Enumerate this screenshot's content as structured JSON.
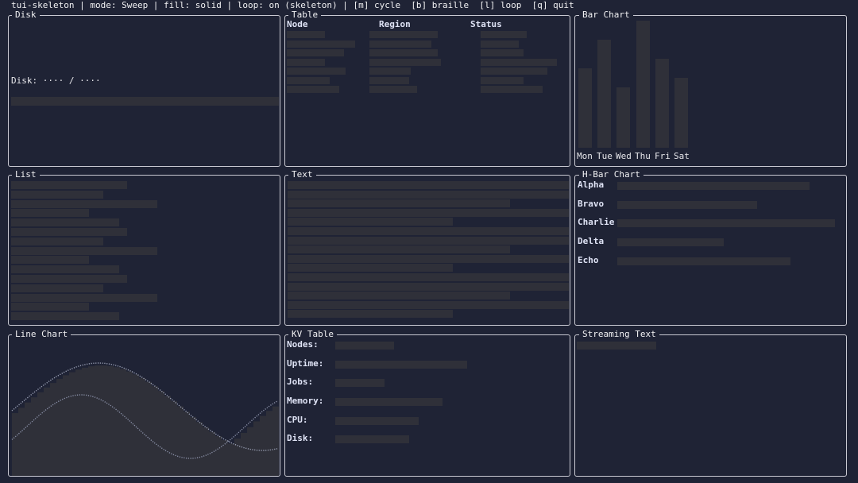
{
  "status_bar": "tui-skeleton | mode: Sweep | fill: solid | loop: on (skeleton) | [m] cycle  [b] braille  [l] loop  [q] quit",
  "panels": {
    "disk": {
      "title": "Disk",
      "label": "Disk: ···· / ····"
    },
    "table": {
      "title": "Table",
      "columns": [
        "Node",
        "Region",
        "Status"
      ]
    },
    "bar_chart": {
      "title": "Bar Chart",
      "days": [
        "Mon",
        "Tue",
        "Wed",
        "Thu",
        "Fri",
        "Sat"
      ]
    },
    "list": {
      "title": "List"
    },
    "text": {
      "title": "Text"
    },
    "hbar_chart": {
      "title": "H-Bar Chart",
      "labels": [
        "Alpha",
        "Bravo",
        "Charlie",
        "Delta",
        "Echo"
      ]
    },
    "line_chart": {
      "title": "Line Chart"
    },
    "kv_table": {
      "title": "KV Table",
      "keys": [
        "Nodes:",
        "Uptime:",
        "Jobs:",
        "Memory:",
        "CPU:",
        "Disk:"
      ]
    },
    "streaming_text": {
      "title": "Streaming Text"
    }
  },
  "colors": {
    "background": "#1f2335",
    "border": "#c9c9d2",
    "skeleton": "#2f3039",
    "text": "#e6e6ea"
  }
}
